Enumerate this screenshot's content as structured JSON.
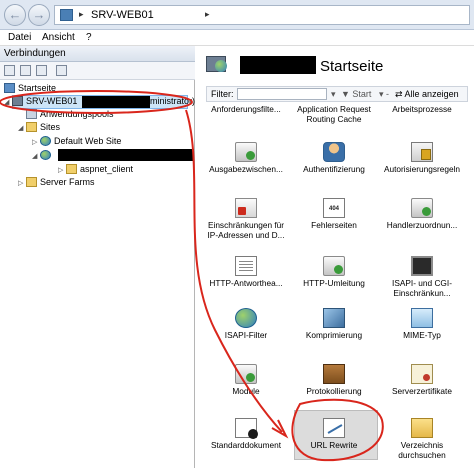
{
  "address": {
    "path": "SRV-WEB01",
    "separator": "▸",
    "tail": "▸"
  },
  "menu": {
    "items": [
      "Datei",
      "Ansicht",
      "?"
    ]
  },
  "connections": {
    "header": "Verbindungen",
    "tree": {
      "start": "Startseite",
      "server": "SRV-WEB01",
      "server_suffix": "ministrator)",
      "app_pools": "Anwendungspools",
      "sites": "Sites",
      "default_site": "Default Web Site",
      "aspnet_client": "aspnet_client",
      "server_farms": "Server Farms"
    }
  },
  "main": {
    "title": "Startseite",
    "filter": {
      "label": "Filter:",
      "start": "Start",
      "show_all": "Alle anzeigen"
    },
    "features": [
      {
        "label": "Anforderungsfilte...",
        "icon": "request-filter-icon"
      },
      {
        "label": "Application Request Routing Cache",
        "icon": "arr-cache-icon"
      },
      {
        "label": "Arbeitsprozesse",
        "icon": "worker-process-icon"
      },
      {
        "label": "Ausgabezwischen...",
        "icon": "output-cache-icon"
      },
      {
        "label": "Authentifizierung",
        "icon": "authentication-icon"
      },
      {
        "label": "Autorisierungsregeln",
        "icon": "authorization-icon"
      },
      {
        "label": "Einschränkungen für IP-Adressen und D...",
        "icon": "ip-restrictions-icon"
      },
      {
        "label": "Fehlerseiten",
        "icon": "error-pages-icon"
      },
      {
        "label": "Handlerzuordnun...",
        "icon": "handler-mappings-icon"
      },
      {
        "label": "HTTP-Antwortheа...",
        "icon": "http-response-headers-icon"
      },
      {
        "label": "HTTP-Umleitung",
        "icon": "http-redirect-icon"
      },
      {
        "label": "ISAPI- und CGI-Einschränkun...",
        "icon": "isapi-cgi-icon"
      },
      {
        "label": "ISAPI-Filter",
        "icon": "isapi-filter-icon"
      },
      {
        "label": "Komprimierung",
        "icon": "compression-icon"
      },
      {
        "label": "MIME-Typ",
        "icon": "mime-type-icon"
      },
      {
        "label": "Module",
        "icon": "modules-icon"
      },
      {
        "label": "Protokollierung",
        "icon": "logging-icon"
      },
      {
        "label": "Serverzertifikate",
        "icon": "server-certificates-icon"
      },
      {
        "label": "Standarddokument",
        "icon": "default-document-icon"
      },
      {
        "label": "URL Rewrite",
        "icon": "url-rewrite-icon"
      },
      {
        "label": "Verzeichnis durchsuchen",
        "icon": "directory-browsing-icon"
      }
    ]
  },
  "colors": {
    "annotation": "#d9261c",
    "selection": "#cce4f7"
  }
}
